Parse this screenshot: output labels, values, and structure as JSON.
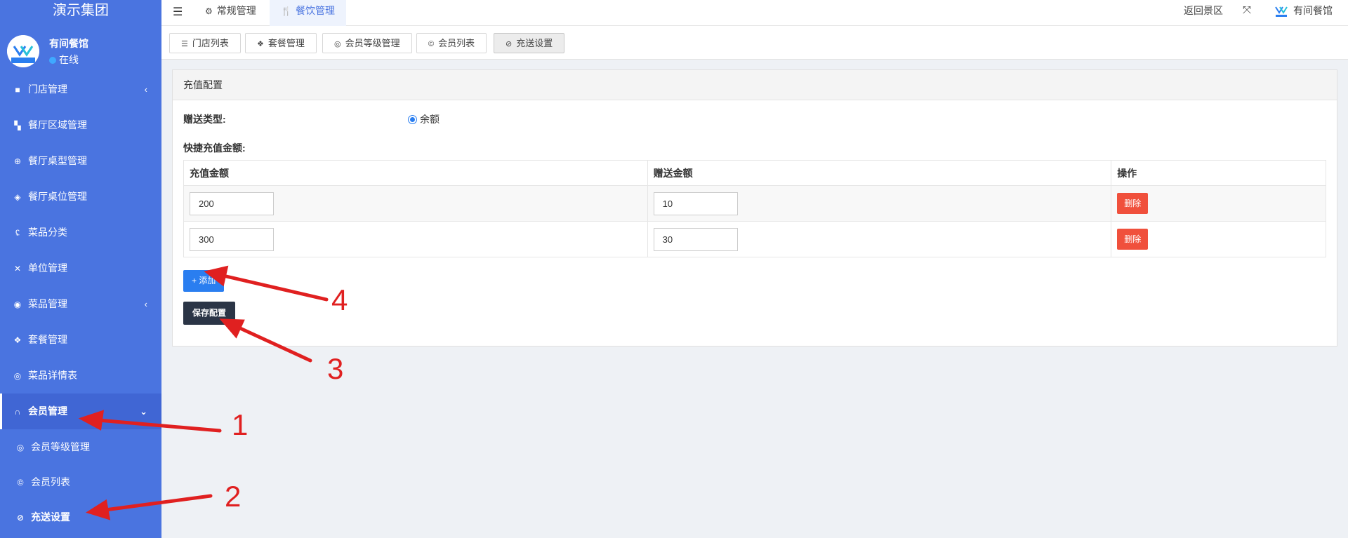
{
  "sidebar": {
    "brand": "演示集团",
    "user_name": "有间餐馆",
    "user_status": "在线",
    "items": [
      {
        "label": "门店管理",
        "icon": "folder-icon",
        "caret": "‹"
      },
      {
        "label": "餐厅区域管理",
        "icon": "grid-icon"
      },
      {
        "label": "餐厅桌型管理",
        "icon": "globe-icon"
      },
      {
        "label": "餐厅桌位管理",
        "icon": "cube-icon"
      },
      {
        "label": "菜品分类",
        "icon": "tag-icon"
      },
      {
        "label": "单位管理",
        "icon": "tools-icon"
      },
      {
        "label": "菜品管理",
        "icon": "dashboard-icon",
        "caret": "‹"
      },
      {
        "label": "套餐管理",
        "icon": "dropbox-icon"
      },
      {
        "label": "菜品详情表",
        "icon": "circle-icon"
      },
      {
        "label": "会员管理",
        "icon": "binoculars-icon",
        "caret": "⌄"
      }
    ],
    "submenu": [
      {
        "label": "会员等级管理",
        "icon": "target-icon"
      },
      {
        "label": "会员列表",
        "icon": "copyright-icon"
      },
      {
        "label": "充送设置",
        "icon": "compass-icon"
      }
    ]
  },
  "header": {
    "tabs": [
      {
        "label": "常规管理",
        "icon": "gears-icon"
      },
      {
        "label": "餐饮管理",
        "icon": "cutlery-icon"
      }
    ],
    "return_label": "返回景区",
    "user_label": "有间餐馆"
  },
  "subtabs": [
    {
      "label": "门店列表",
      "icon": "list-icon"
    },
    {
      "label": "套餐管理",
      "icon": "dropbox-icon"
    },
    {
      "label": "会员等级管理",
      "icon": "target-icon"
    },
    {
      "label": "会员列表",
      "icon": "copyright-icon"
    },
    {
      "label": "充送设置",
      "icon": "compass-icon"
    }
  ],
  "panel": {
    "title": "充值配置",
    "gift_type_label": "赠送类型:",
    "gift_type_option": "余额",
    "quick_label": "快捷充值金额:",
    "columns": [
      "充值金额",
      "赠送金额",
      "操作"
    ],
    "rows": [
      {
        "amount": "200",
        "gift": "10",
        "action": "删除"
      },
      {
        "amount": "300",
        "gift": "30",
        "action": "删除"
      }
    ],
    "add_label": "+ 添加",
    "save_label": "保存配置"
  },
  "annotations": [
    "1",
    "2",
    "3",
    "4"
  ],
  "colors": {
    "sidebar": "#4a74e0",
    "primary": "#2a7ef0",
    "danger": "#f0503c",
    "dark": "#2b3546",
    "annotation": "#e02020"
  }
}
